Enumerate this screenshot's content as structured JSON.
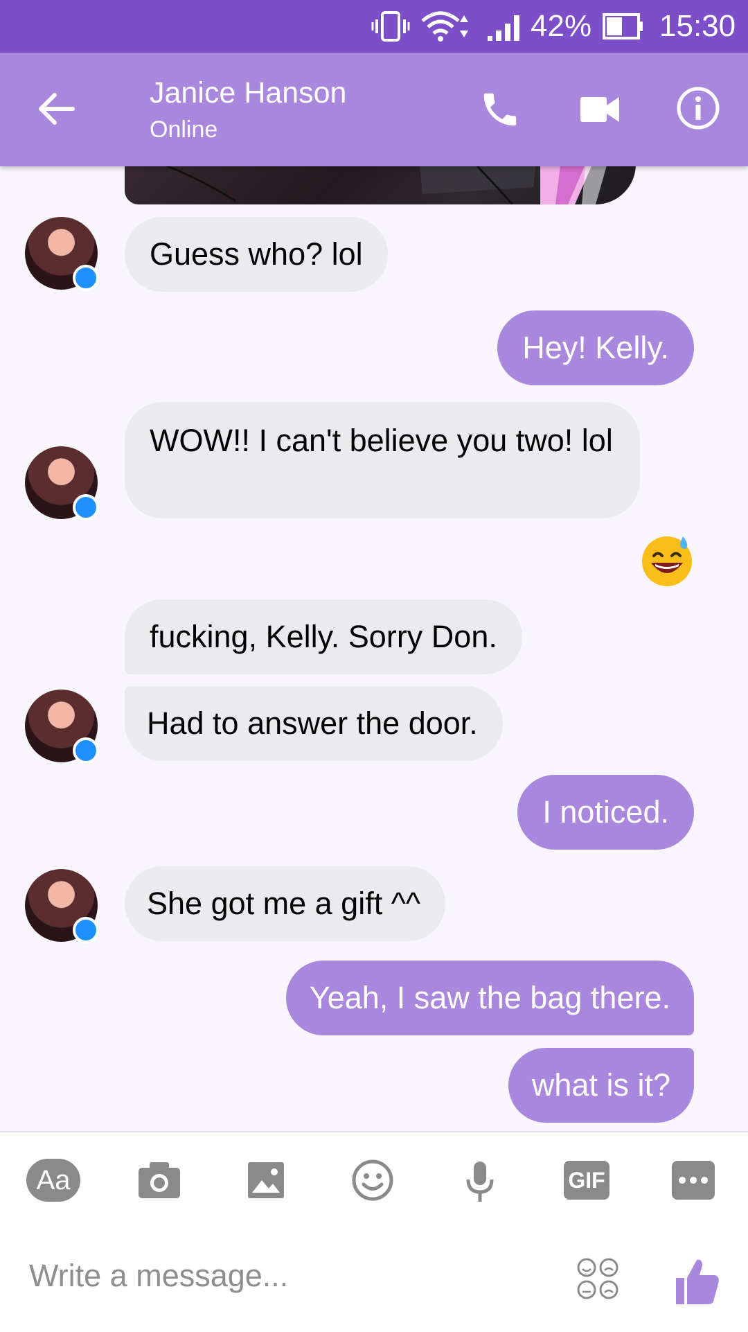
{
  "status_bar": {
    "battery": "42%",
    "time": "15:30"
  },
  "header": {
    "contact_name": "Janice Hanson",
    "contact_status": "Online"
  },
  "messages": [
    {
      "side": "in",
      "text": "Guess who? lol"
    },
    {
      "side": "out",
      "text": "Hey! Kelly."
    },
    {
      "side": "in",
      "text": "WOW!! I can't believe you two! lol"
    },
    {
      "side": "out",
      "emoji": "grinning-sweat"
    },
    {
      "side": "in",
      "text": "fucking, Kelly. Sorry Don."
    },
    {
      "side": "in",
      "text": "Had to answer the door."
    },
    {
      "side": "out",
      "text": "I noticed."
    },
    {
      "side": "in",
      "text": "She got me a gift ^^"
    },
    {
      "side": "out",
      "text": "Yeah, I saw the bag there."
    },
    {
      "side": "out",
      "text": "what is it?"
    }
  ],
  "composer": {
    "text_format_label": "Aa",
    "gif_label": "GIF",
    "placeholder": "Write a message..."
  },
  "colors": {
    "status_bar": "#7c4fc8",
    "header": "#a887dc",
    "outgoing_bubble": "#a887dc",
    "incoming_bubble": "#ebeaef",
    "toolbar_icon": "#8a8a8a",
    "like_icon": "#a887dc"
  }
}
